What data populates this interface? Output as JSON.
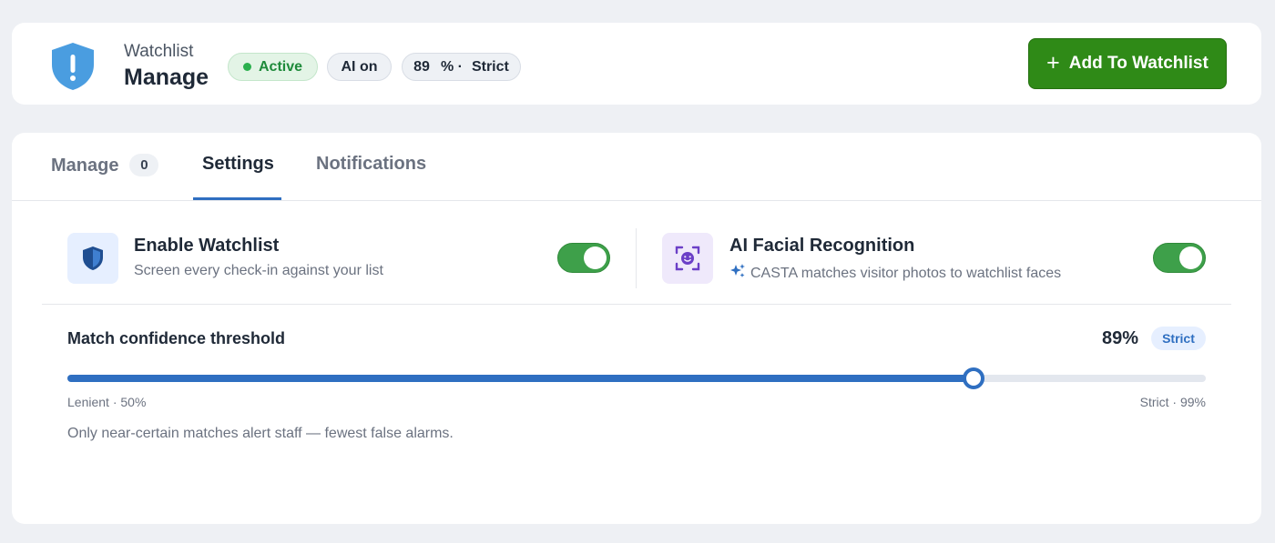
{
  "header": {
    "subtitle": "Watchlist",
    "title": "Manage",
    "status_pill": "Active",
    "ai_pill": "AI on",
    "threshold_pill": {
      "value": "89",
      "suffix": "% ·",
      "mode": "Strict"
    },
    "add_button": "Add To Watchlist",
    "shield_icon": "shield-exclamation-icon"
  },
  "tabs": [
    {
      "label": "Manage",
      "count": "0",
      "active": false
    },
    {
      "label": "Settings",
      "active": true
    },
    {
      "label": "Notifications",
      "active": false
    }
  ],
  "settings": {
    "watchlist": {
      "icon": "shield-icon",
      "title": "Enable Watchlist",
      "description": "Screen every check-in against your list",
      "enabled": true
    },
    "facial": {
      "icon": "face-scan-icon",
      "title": "AI Facial Recognition",
      "description": "CASTA matches visitor photos to watchlist faces",
      "sparkle_icon": "sparkle-icon",
      "enabled": true
    },
    "threshold": {
      "label": "Match confidence threshold",
      "value_text": "89%",
      "badge": "Strict",
      "min_label": "Lenient · 50%",
      "max_label": "Strict · 99%",
      "min": 50,
      "max": 99,
      "value": 89,
      "help": "Only near-certain matches alert staff — fewest false alarms."
    }
  },
  "colors": {
    "accent": "#2f6fc1",
    "success": "#2f8a17",
    "toggle_on": "#3ea04a",
    "page_bg": "#eef0f4"
  }
}
